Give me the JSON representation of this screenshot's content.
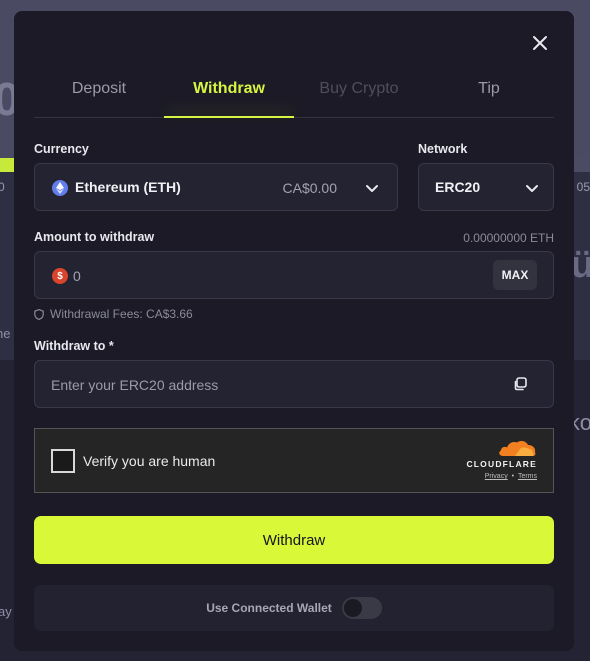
{
  "background": {
    "big_left": "0,",
    "big_right": "ü",
    "num_left": "0",
    "num_right": "05",
    "txt_left": "he",
    "txt_right": "ko",
    "txt_left2": "ay"
  },
  "tabs": [
    {
      "label": "Deposit",
      "state": "normal"
    },
    {
      "label": "Withdraw",
      "state": "active"
    },
    {
      "label": "Buy Crypto",
      "state": "disabled"
    },
    {
      "label": "Tip",
      "state": "normal"
    }
  ],
  "currency": {
    "label": "Currency",
    "selected": "Ethereum (ETH)",
    "value": "CA$0.00",
    "icon": "ethereum-icon"
  },
  "network": {
    "label": "Network",
    "selected": "ERC20"
  },
  "amount": {
    "label": "Amount to withdraw",
    "balance": "0.00000000 ETH",
    "placeholder": "0",
    "max_label": "MAX",
    "fees_text": "Withdrawal Fees: CA$3.66"
  },
  "withdraw_to": {
    "label": "Withdraw to *",
    "placeholder": "Enter your ERC20 address"
  },
  "captcha": {
    "text": "Verify you are human",
    "brand": "CLOUDFLARE",
    "privacy": "Privacy",
    "separator": "•",
    "terms": "Terms"
  },
  "submit": {
    "label": "Withdraw"
  },
  "wallet": {
    "label": "Use Connected Wallet",
    "enabled": false
  },
  "colors": {
    "accent": "#d8f838",
    "modal_bg": "#1b1a26",
    "ethereum": "#627eea",
    "cloudflare": "#f38020"
  }
}
